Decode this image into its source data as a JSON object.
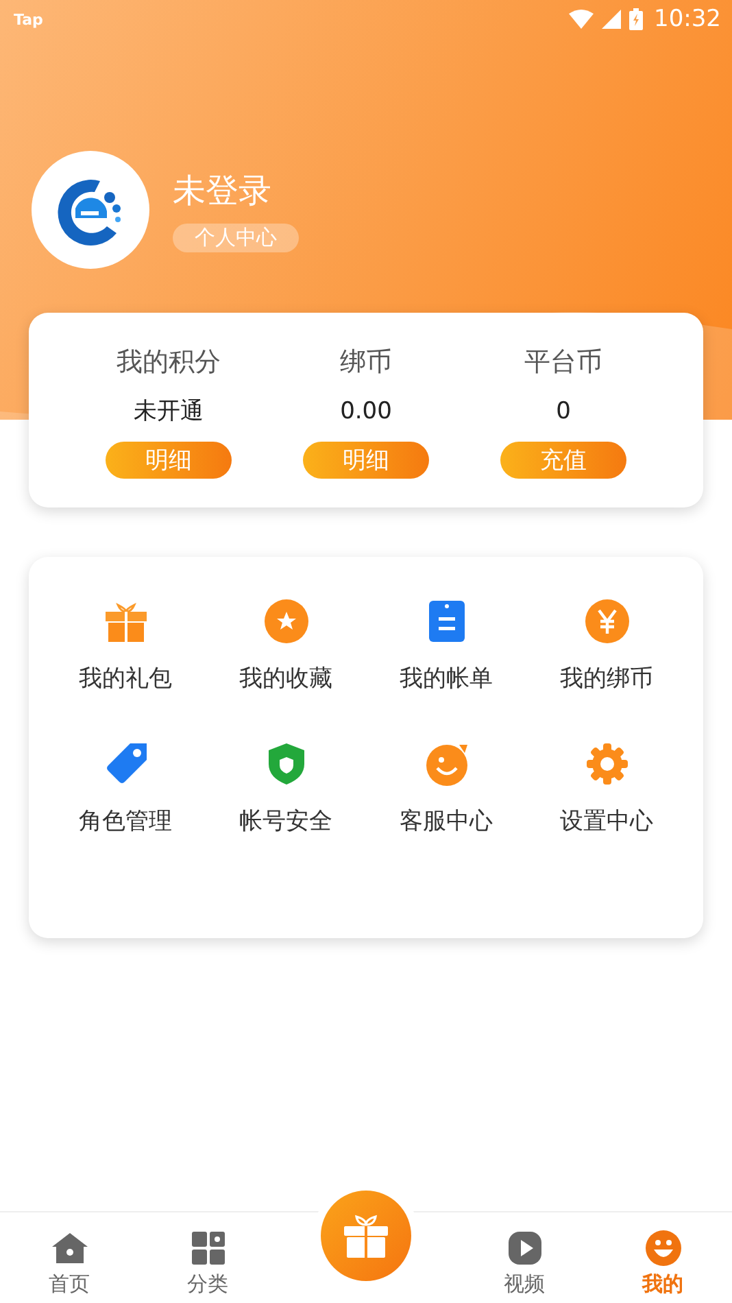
{
  "status_bar": {
    "carrier": "Tap",
    "time": "10:32"
  },
  "profile": {
    "name": "未登录",
    "badge": "个人中心"
  },
  "stats": [
    {
      "label": "我的积分",
      "value": "未开通",
      "action": "明细"
    },
    {
      "label": "绑币",
      "value": "0.00",
      "action": "明细"
    },
    {
      "label": "平台币",
      "value": "0",
      "action": "充值"
    }
  ],
  "menu": [
    {
      "label": "我的礼包"
    },
    {
      "label": "我的收藏"
    },
    {
      "label": "我的帐单"
    },
    {
      "label": "我的绑币"
    },
    {
      "label": "角色管理"
    },
    {
      "label": "帐号安全"
    },
    {
      "label": "客服中心"
    },
    {
      "label": "设置中心"
    }
  ],
  "tabs": [
    {
      "label": "首页",
      "selected": false
    },
    {
      "label": "分类",
      "selected": false
    },
    {
      "label": "视频",
      "selected": false
    },
    {
      "label": "我的",
      "selected": true
    }
  ]
}
